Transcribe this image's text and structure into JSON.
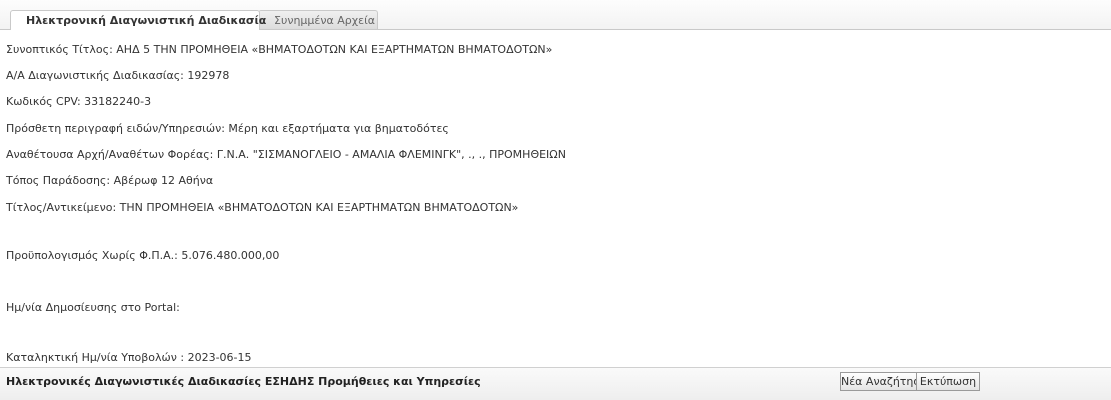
{
  "tabs": [
    {
      "label": "Ηλεκτρονική Διαγωνιστική Διαδικασία",
      "active": true
    },
    {
      "label": "Συνημμένα Αρχεία",
      "active": false
    }
  ],
  "details": {
    "summary_title": "Συνοπτικός Τίτλος: ΑΗΔ 5 ΤΗΝ ΠΡΟΜΗΘΕΙΑ «ΒΗΜΑΤΟΔΟΤΩΝ ΚΑΙ ΕΞΑΡΤΗΜΑΤΩΝ ΒΗΜΑΤΟΔΟΤΩΝ»",
    "procedure_no": "Α/Α Διαγωνιστικής Διαδικασίας: 192978",
    "cpv_code": "Κωδικός CPV: 33182240-3",
    "extra_description": "Πρόσθετη περιγραφή ειδών/Υπηρεσιών: Μέρη και εξαρτήματα για βηματοδότες",
    "contracting_authority": "Αναθέτουσα Αρχή/Αναθέτων Φορέας: Γ.Ν.Α. \"ΣΙΣΜΑΝΟΓΛΕΙΟ - ΑΜΑΛΙΑ ΦΛΕΜΙΝΓΚ\", ., ., ΠΡΟΜΗΘΕΙΩΝ",
    "delivery_place": "Τόπος Παράδοσης: Αβέρωφ 12 Αθήνα",
    "subject": "Τίτλος/Αντικείμενο: ΤΗΝ ΠΡΟΜΗΘΕΙΑ «ΒΗΜΑΤΟΔΟΤΩΝ ΚΑΙ ΕΞΑΡΤΗΜΑΤΩΝ ΒΗΜΑΤΟΔΟΤΩΝ»",
    "budget": "Προϋπολογισμός Χωρίς Φ.Π.Α.: 5.076.480.000,00",
    "portal_date": "Ημ/νία Δημοσίευσης στο Portal:",
    "deadline": "Καταληκτική Ημ/νία Υποβολών : 2023-06-15"
  },
  "footer": {
    "title": "Ηλεκτρονικές Διαγωνιστικές Διαδικασίες ΕΣΗΔΗΣ Προμήθειες και Υπηρεσίες",
    "new_search_label": "Νέα Αναζήτηση",
    "print_label": "Εκτύπωση"
  }
}
